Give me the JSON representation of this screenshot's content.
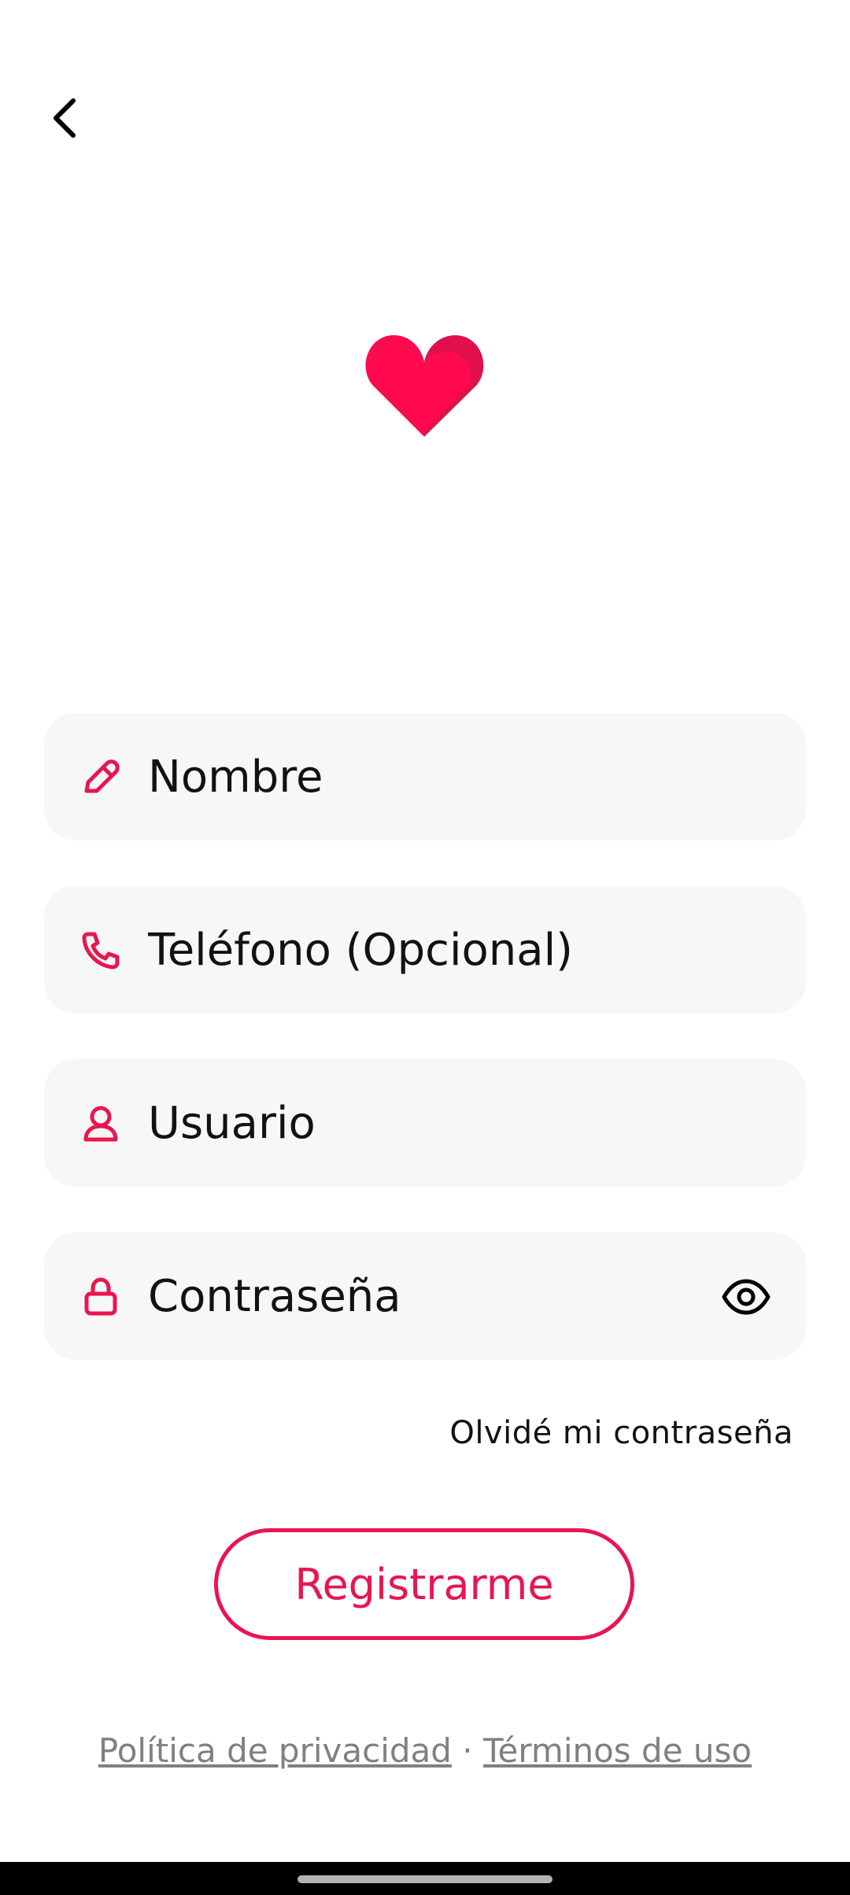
{
  "colors": {
    "accent": "#e8164f",
    "field_background": "#f7f7f7",
    "text": "#121212",
    "link_gray": "#808080"
  },
  "header": {
    "back_icon": "chevron-left-icon"
  },
  "logo": {
    "icon": "heart-logo-icon"
  },
  "form": {
    "name": {
      "placeholder": "Nombre",
      "icon": "pencil-icon"
    },
    "phone": {
      "placeholder": "Teléfono (Opcional)",
      "icon": "phone-icon"
    },
    "username": {
      "placeholder": "Usuario",
      "icon": "user-icon"
    },
    "password": {
      "placeholder": "Contraseña",
      "icon": "lock-icon",
      "toggle_icon": "eye-icon"
    },
    "forgot_password": "Olvidé mi contraseña",
    "register_button": "Registrarme"
  },
  "footer": {
    "privacy": "Política de privacidad",
    "separator": "·",
    "terms": "Términos de uso"
  }
}
